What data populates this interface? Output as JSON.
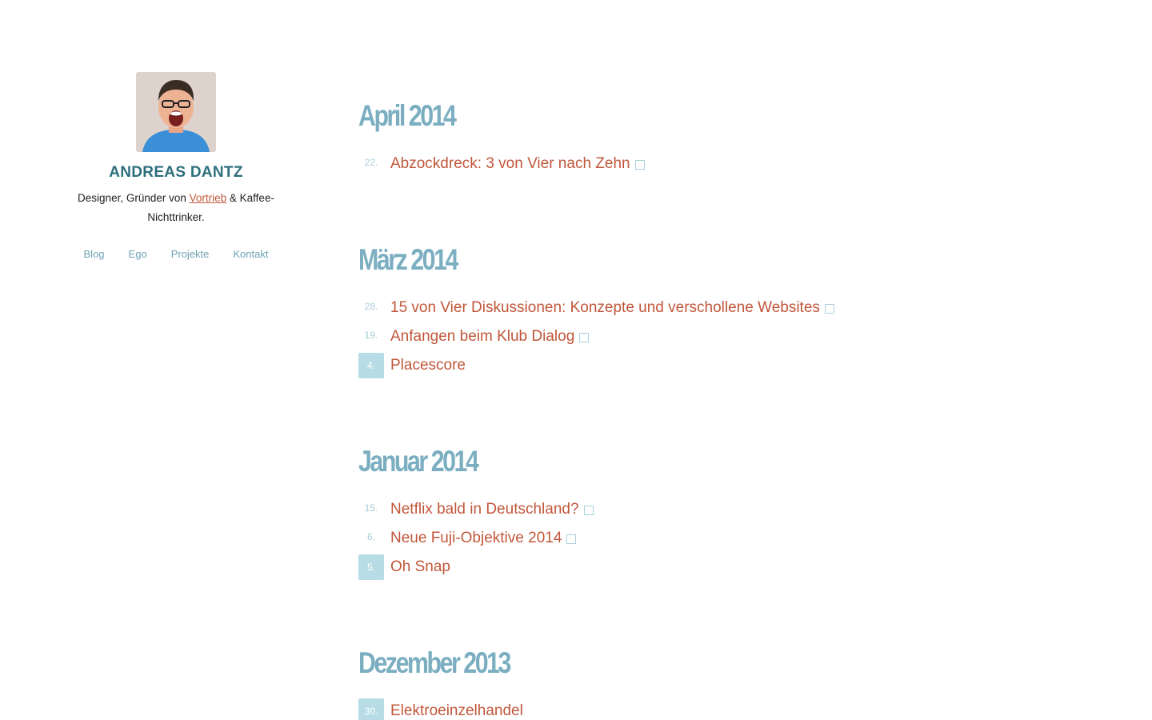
{
  "sidebar": {
    "author_name": "ANDREAS DANTZ",
    "tagline_prefix": "Designer, Gründer von ",
    "tagline_link": "Vortrieb",
    "tagline_suffix": " & Kaffee-Nichttrinker.",
    "nav": [
      "Blog",
      "Ego",
      "Projekte",
      "Kontakt"
    ]
  },
  "archive": [
    {
      "month": "April 2014",
      "posts": [
        {
          "day": "22.",
          "title": "Abzockdreck: 3 von Vier nach Zehn",
          "type": "link"
        }
      ]
    },
    {
      "month": "März 2014",
      "posts": [
        {
          "day": "28.",
          "title": "15 von Vier Diskussionen: Konzepte und verschollene Websites",
          "type": "link"
        },
        {
          "day": "19.",
          "title": "Anfangen beim Klub Dialog",
          "type": "link"
        },
        {
          "day": "4.",
          "title": "Placescore",
          "type": "article"
        }
      ]
    },
    {
      "month": "Januar 2014",
      "posts": [
        {
          "day": "15.",
          "title": "Netflix bald in Deutschland?",
          "type": "link"
        },
        {
          "day": "6.",
          "title": "Neue Fuji-Objektive 2014",
          "type": "link"
        },
        {
          "day": "5.",
          "title": "Oh Snap",
          "type": "article"
        }
      ]
    },
    {
      "month": "Dezember 2013",
      "posts": [
        {
          "day": "30.",
          "title": "Elektroeinzelhandel",
          "type": "article"
        }
      ]
    }
  ],
  "colors": {
    "accent_link": "#c0573a",
    "month_heading": "#7aaec0",
    "author_name": "#2c6e7c",
    "highlight_day_bg": "#b8dce5"
  }
}
